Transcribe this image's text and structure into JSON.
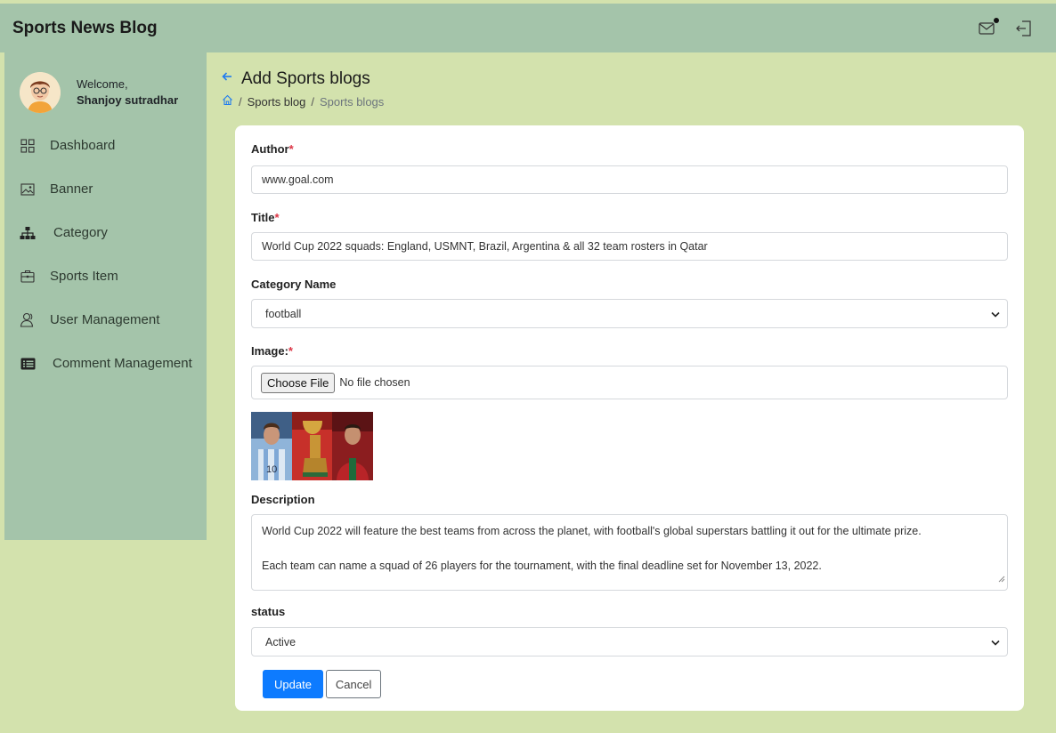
{
  "app": {
    "title": "Sports News Blog"
  },
  "sidebar": {
    "welcome": "Welcome,",
    "user_name": "Shanjoy sutradhar",
    "items": [
      {
        "label": "Dashboard",
        "icon": "dashboard-icon"
      },
      {
        "label": "Banner",
        "icon": "image-icon"
      },
      {
        "label": "Category",
        "icon": "hierarchy-icon"
      },
      {
        "label": "Sports Item",
        "icon": "briefcase-icon"
      },
      {
        "label": "User Management",
        "icon": "users-icon"
      },
      {
        "label": "Comment Management",
        "icon": "list-icon"
      }
    ]
  },
  "header": {
    "title": "Add Sports blogs",
    "breadcrumb": {
      "sep": "/",
      "parent": "Sports blog",
      "current": "Sports blogs"
    }
  },
  "form": {
    "author": {
      "label": "Author",
      "required_mark": "*",
      "value": "www.goal.com"
    },
    "title": {
      "label": "Title",
      "required_mark": "*",
      "value": "World Cup 2022 squads: England, USMNT, Brazil, Argentina & all 32 team rosters in Qatar"
    },
    "category": {
      "label": "Category Name",
      "value": "football"
    },
    "image": {
      "label": "Image:",
      "required_mark": "*",
      "button": "Choose File",
      "status": "No file chosen"
    },
    "description": {
      "label": "Description",
      "paragraphs": [
        "World Cup 2022 will feature the best teams from across the planet, with football's global superstars battling it out for the ultimate prize.",
        "Each team can name a squad of 26 players for the tournament, with the final deadline set for November 13, 2022."
      ]
    },
    "status": {
      "label": "status",
      "value": "Active"
    },
    "update_label": "Update",
    "cancel_label": "Cancel"
  },
  "colors": {
    "topbar": "#a4c4aa",
    "background": "#d3e2ad",
    "primary": "#0d7bff",
    "required": "#dc3545"
  }
}
